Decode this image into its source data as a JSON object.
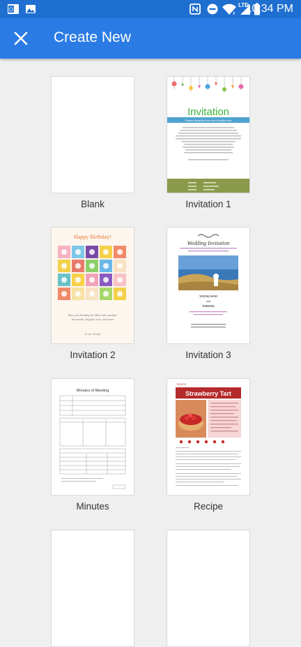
{
  "status_bar": {
    "time": "10:34 PM",
    "lte": "LTE"
  },
  "app_bar": {
    "title": "Create New"
  },
  "templates": [
    {
      "label": "Blank"
    },
    {
      "label": "Invitation 1",
      "heading": "Invitation",
      "subheading": "Please describe the event briefly here"
    },
    {
      "label": "Invitation 2",
      "heading": "Happy Birthday!",
      "message_line1": "May your birthday be filled with sunshine",
      "message_line2": "and smiles, laughter, love, and cheer",
      "signature": "From. Friend"
    },
    {
      "label": "Invitation 3",
      "heading": "Wedding Invitation",
      "groom": "YOUNG WOO",
      "and": "and",
      "bride": "NAHANG"
    },
    {
      "label": "Minutes",
      "heading": "Minutes of Meeting"
    },
    {
      "label": "Recipe",
      "badge": "RECIPE",
      "heading": "Strawberry Tart"
    }
  ]
}
